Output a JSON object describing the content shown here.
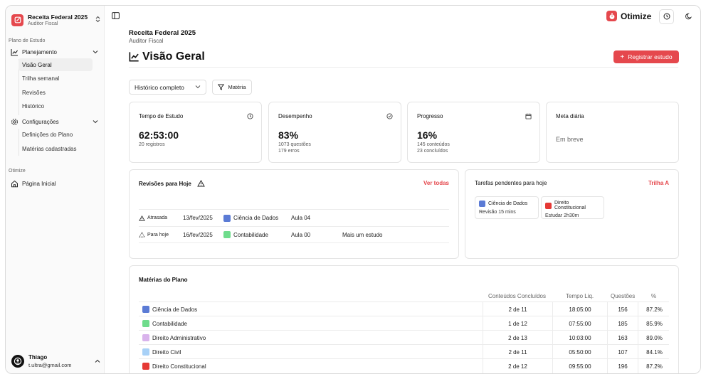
{
  "colors": {
    "accent": "#e5484d",
    "swatch_blue": "#5b7bd5",
    "swatch_green": "#6fdc8c",
    "swatch_red": "#e53935",
    "swatch_purple": "#d9b3ec",
    "swatch_lightblue": "#a8d1f7"
  },
  "sidebar": {
    "workspace": {
      "title": "Receita Federal 2025",
      "subtitle": "Auditor Fiscal"
    },
    "section_plan": "Plano de Estudo",
    "planejamento": {
      "label": "Planejamento",
      "items": [
        "Visão Geral",
        "Trilha semanal",
        "Revisões",
        "Histórico"
      ]
    },
    "configuracoes": {
      "label": "Configurações",
      "items": [
        "Definições do Plano",
        "Matérias cadastradas"
      ]
    },
    "section_otimize": "Otimize",
    "home": "Página Inicial",
    "user": {
      "name": "Thiago",
      "email": "t.ultra@gmail.com"
    }
  },
  "header": {
    "brand": "Otimize"
  },
  "page": {
    "breadcrumb_title": "Receita Federal 2025",
    "breadcrumb_sub": "Auditor Fiscal",
    "title": "Visão Geral",
    "register_button": "Registrar estudo"
  },
  "filters": {
    "select_value": "Histórico completo",
    "subject_button": "Matéria"
  },
  "stats": [
    {
      "title": "Tempo de Estudo",
      "value": "62:53:00",
      "lines": [
        "20 registros"
      ]
    },
    {
      "title": "Desempenho",
      "value": "83%",
      "lines": [
        "1073 questões",
        "179 erros"
      ]
    },
    {
      "title": "Progresso",
      "value": "16%",
      "lines": [
        "145 conteúdos",
        "23 concluídos"
      ]
    },
    {
      "title": "Meta diária",
      "body": "Em breve"
    }
  ],
  "revisions": {
    "title": "Revisões para Hoje",
    "link": "Ver todas",
    "rows": [
      {
        "status": "Atrasada",
        "date": "13/fev/2025",
        "subject": "Ciência de Dados",
        "lesson": "Aula 04",
        "note": ""
      },
      {
        "status": "Para hoje",
        "date": "16/fev/2025",
        "subject": "Contabilidade",
        "lesson": "Aula 00",
        "note": "Mais um estudo"
      }
    ]
  },
  "tasks": {
    "title": "Tarefas pendentes para hoje",
    "link": "Trilha A",
    "items": [
      {
        "subject": "Ciência de Dados",
        "detail": "Revisão 15 mins"
      },
      {
        "subject": "Direito Constitucional",
        "detail": "Estudar 2h30m"
      }
    ]
  },
  "subjects_table": {
    "title": "Matérias do Plano",
    "headers": [
      "Conteúdos Concluídos",
      "Tempo Liq.",
      "Questões",
      "%"
    ],
    "rows": [
      {
        "name": "Ciência de Dados",
        "done": "2 de 11",
        "time": "18:05:00",
        "questions": "156",
        "pct": "87.2%"
      },
      {
        "name": "Contabilidade",
        "done": "1 de 12",
        "time": "07:55:00",
        "questions": "185",
        "pct": "85.9%"
      },
      {
        "name": "Direito Administrativo",
        "done": "2 de 13",
        "time": "10:03:00",
        "questions": "163",
        "pct": "89.0%"
      },
      {
        "name": "Direito Civil",
        "done": "2 de 11",
        "time": "05:50:00",
        "questions": "107",
        "pct": "84.1%"
      },
      {
        "name": "Direito Constitucional",
        "done": "2 de 12",
        "time": "09:55:00",
        "questions": "196",
        "pct": "87.2%"
      }
    ]
  }
}
